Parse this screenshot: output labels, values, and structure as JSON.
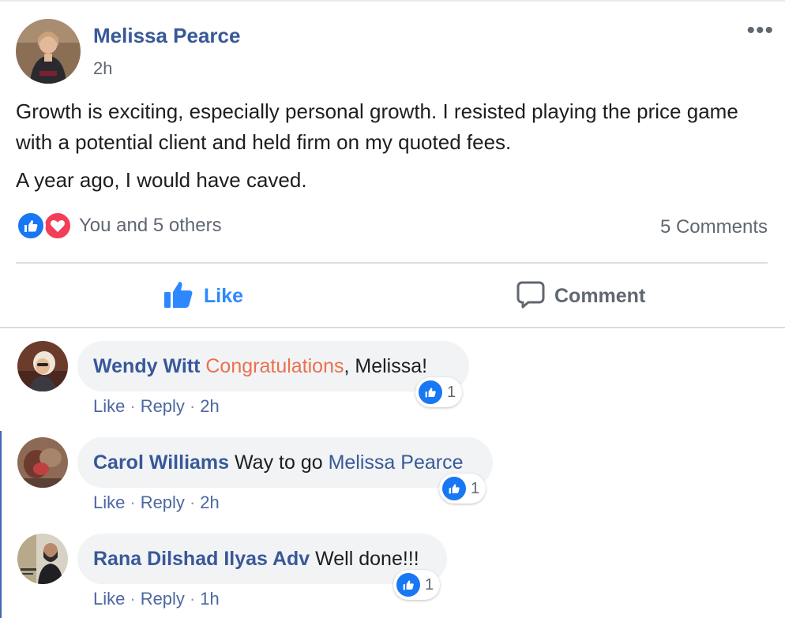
{
  "post": {
    "author": "Melissa Pearce",
    "time": "2h",
    "more_icon": "•••",
    "paragraphs": [
      "Growth is exciting, especially personal growth. I resisted playing the price game with a potential client and held firm on my quoted fees.",
      "A year ago, I would have caved."
    ],
    "reactions_text": "You and 5 others",
    "comments_count": "5 Comments",
    "like_label": "Like",
    "comment_label": "Comment"
  },
  "colors": {
    "link": "#385898",
    "like_blue": "#1877f2",
    "love_red": "#f33e58",
    "highlight": "#e9714f",
    "bubble_bg": "#f2f3f5"
  },
  "comments": [
    {
      "name": "Wendy Witt",
      "highlight": "Congratulations",
      "text": ", Melissa!",
      "likes": "1",
      "like_label": "Like",
      "reply_label": "Reply",
      "time": "2h"
    },
    {
      "name": "Carol Williams",
      "text": "Way to go",
      "mention": "Melissa Pearce",
      "likes": "1",
      "like_label": "Like",
      "reply_label": "Reply",
      "time": "2h"
    },
    {
      "name": "Rana Dilshad Ilyas Adv",
      "text": "Well done!!!",
      "likes": "1",
      "like_label": "Like",
      "reply_label": "Reply",
      "time": "1h"
    }
  ]
}
